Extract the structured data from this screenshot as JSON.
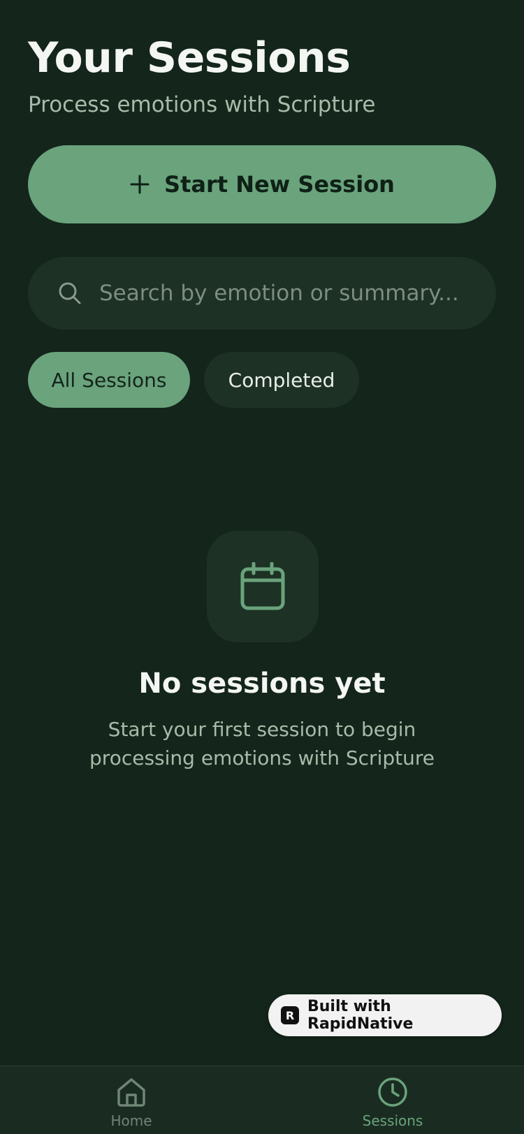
{
  "header": {
    "title": "Your Sessions",
    "subtitle": "Process emotions with Scripture"
  },
  "start_button": {
    "label": "Start New Session",
    "icon": "plus-icon"
  },
  "search": {
    "placeholder": "Search by emotion or summary...",
    "value": "",
    "icon": "search-icon"
  },
  "filters": {
    "items": [
      {
        "label": "All Sessions",
        "active": true
      },
      {
        "label": "Completed",
        "active": false
      }
    ]
  },
  "empty_state": {
    "icon": "calendar-icon",
    "title": "No sessions yet",
    "description": "Start your first session to begin processing emotions with Scripture"
  },
  "badge": {
    "label": "Built with RapidNative",
    "icon": "rapidnative-logo"
  },
  "tabbar": {
    "items": [
      {
        "label": "Home",
        "icon": "home-icon",
        "active": false
      },
      {
        "label": "Sessions",
        "icon": "clock-icon",
        "active": true
      }
    ]
  },
  "colors": {
    "background": "#14251b",
    "accent": "#6aa37c",
    "surface": "#1d3125",
    "muted_text": "#a7bba9"
  }
}
